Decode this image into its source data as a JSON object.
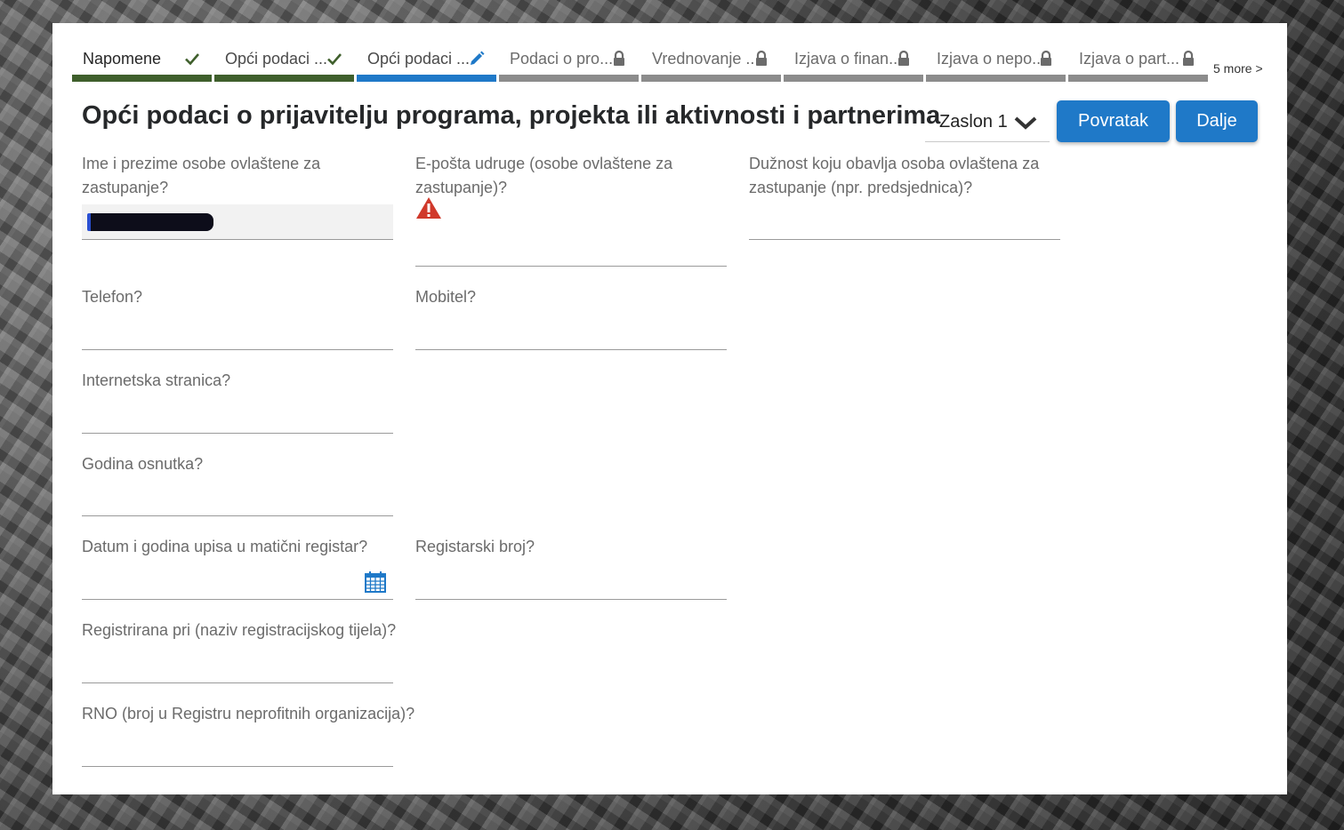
{
  "steps": [
    {
      "label": "Napomene",
      "state": "done",
      "icon": "check-icon"
    },
    {
      "label": "Opći podaci ...",
      "state": "done",
      "icon": "check-icon"
    },
    {
      "label": "Opći podaci ...",
      "state": "current",
      "icon": "pencil-icon"
    },
    {
      "label": "Podaci o pro...",
      "state": "locked",
      "icon": "lock-icon"
    },
    {
      "label": "Vrednovanje ...",
      "state": "locked",
      "icon": "lock-icon"
    },
    {
      "label": "Izjava o finan...",
      "state": "locked",
      "icon": "lock-icon"
    },
    {
      "label": "Izjava o nepo...",
      "state": "locked",
      "icon": "lock-icon"
    },
    {
      "label": "Izjava o part...",
      "state": "locked",
      "icon": "lock-icon"
    }
  ],
  "more_label": "5 more >",
  "page_title": "Opći podaci o prijavitelju programa, projekta ili aktivnosti i partnerima",
  "screen_select": {
    "value": "Zaslon 1"
  },
  "buttons": {
    "back": "Povratak",
    "next": "Dalje"
  },
  "fields": {
    "name": {
      "label": "Ime i prezime osobe ovlaštene za zastupanje?",
      "value": ""
    },
    "email": {
      "label": "E-pošta udruge (osobe ovlaštene za zastupanje)?",
      "value": ""
    },
    "duty": {
      "label": "Dužnost koju obavlja osoba ovlaštena za zastupanje (npr. predsjednica)?",
      "value": ""
    },
    "phone": {
      "label": "Telefon?",
      "value": ""
    },
    "mobile": {
      "label": "Mobitel?",
      "value": ""
    },
    "website": {
      "label": "Internetska stranica?",
      "value": ""
    },
    "founding_year": {
      "label": "Godina osnutka?",
      "value": ""
    },
    "registry_date": {
      "label": "Datum i godina upisa u matični registar?",
      "value": ""
    },
    "registry_number": {
      "label": "Registarski broj?",
      "value": ""
    },
    "registered_at": {
      "label": "Registrirana pri (naziv registracijskog tijela)?",
      "value": ""
    },
    "rno": {
      "label": "RNO (broj u Registru neprofitnih organizacija)?",
      "value": ""
    }
  },
  "colors": {
    "accent": "#1f79c8",
    "done": "#3f5f2c",
    "locked": "#8c8c8c",
    "warning": "#d0392b"
  }
}
